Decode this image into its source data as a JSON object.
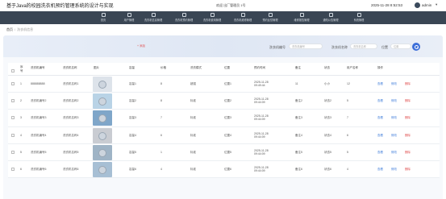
{
  "header": {
    "app_title": "基于Java的校园洗衣机预约管理系统的设计与实现",
    "welcome": "欢迎 出厂管理员 1号",
    "datetime": "2025-11-28 8:52:53",
    "username": "admin",
    "caret": "▾"
  },
  "nav": [
    {
      "label": "首页",
      "icon": "home-icon"
    },
    {
      "label": "用户管理",
      "icon": "user-icon"
    },
    {
      "label": "洗衣机信息管理",
      "icon": "washer-icon"
    },
    {
      "label": "洗衣机预约管理",
      "icon": "calendar-icon"
    },
    {
      "label": "洗衣机使用管理",
      "icon": "list-icon"
    },
    {
      "label": "洗衣机维修管理",
      "icon": "wrench-icon"
    },
    {
      "label": "预约反馈管理",
      "icon": "message-icon"
    },
    {
      "label": "维修报告管理",
      "icon": "report-icon"
    },
    {
      "label": "通知公告管理",
      "icon": "bell-icon"
    },
    {
      "label": "系统管理",
      "icon": "settings-icon"
    }
  ],
  "breadcrumb": {
    "home": "首页",
    "current": "洗衣机信息"
  },
  "toolbar": {
    "add_label": "+ 添加"
  },
  "search": {
    "field1_label": "洗衣机编号",
    "field1_placeholder": "洗衣机编号",
    "field2_label": "洗衣机名称",
    "field2_placeholder": "洗衣机名称",
    "field3_label": "位置",
    "field3_placeholder": "位置"
  },
  "table": {
    "headers": [
      "序号",
      "洗衣机编号",
      "洗衣机名称",
      "图片",
      "容量",
      "价格",
      "洗衣模式",
      "位置",
      "预约时间",
      "备注",
      "状态",
      "用户名称",
      "操作"
    ],
    "actions": {
      "view": "查看",
      "edit": "修改",
      "delete": "删除"
    },
    "rows": [
      {
        "no": "1",
        "code": "888888888",
        "name": "洗衣机名称1",
        "capacity": "容量1",
        "price": "8",
        "mode": "超强",
        "location": "位置1",
        "time": "2025-11-28 09:49:44",
        "note": "11",
        "status": "小小",
        "user": "12"
      },
      {
        "no": "2",
        "code": "洗衣机编号2",
        "name": "洗衣机名称2",
        "capacity": "容量2",
        "price": "8",
        "mode": "标准",
        "location": "位置2",
        "time": "2025-11-28 09:44:09",
        "note": "备注2",
        "status": "状态2",
        "user": "5"
      },
      {
        "no": "3",
        "code": "洗衣机编号3",
        "name": "洗衣机名称3",
        "capacity": "容量3",
        "price": "7",
        "mode": "标准",
        "location": "位置3",
        "time": "2025-11-28 09:44:09",
        "note": "备注3",
        "status": "状态3",
        "user": "7"
      },
      {
        "no": "4",
        "code": "洗衣机编号4",
        "name": "洗衣机名称4",
        "capacity": "容量4",
        "price": "6",
        "mode": "标准",
        "location": "位置4",
        "time": "2025-11-28 09:44:09",
        "note": "备注4",
        "status": "状态4",
        "user": "6"
      },
      {
        "no": "5",
        "code": "洗衣机编号5",
        "name": "洗衣机名称5",
        "capacity": "容量5",
        "price": "1",
        "mode": "标准",
        "location": "位置5",
        "time": "2025-11-28 09:44:09",
        "note": "备注5",
        "status": "状态5",
        "user": "5"
      },
      {
        "no": "6",
        "code": "洗衣机编号6",
        "name": "洗衣机名称6",
        "capacity": "容量6",
        "price": "4",
        "mode": "标准",
        "location": "位置6",
        "time": "2025-11-28 09:44:09",
        "note": "备注6",
        "status": "状态6",
        "user": "4"
      }
    ]
  },
  "colors": {
    "nav_bg": "#3a4654",
    "accent": "#3d6fd9",
    "danger": "#e05050",
    "banner": "#dfe7f4"
  }
}
